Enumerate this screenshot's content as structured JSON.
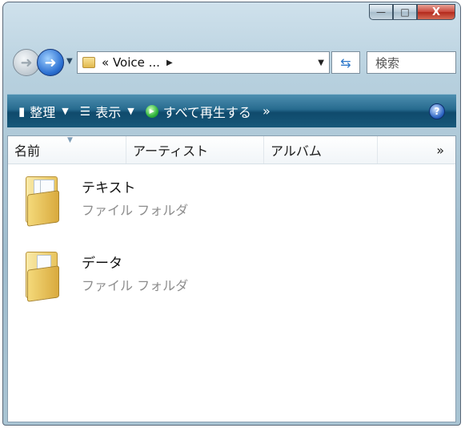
{
  "window": {
    "caption_buttons": {
      "minimize": "—",
      "maximize": "□",
      "close": "X"
    }
  },
  "address": {
    "path_text": "« Voice ...",
    "search_placeholder": "検索",
    "icons": {
      "back": "back-arrow-icon",
      "forward": "forward-arrow-icon",
      "refresh": "refresh-icon"
    }
  },
  "toolbar": {
    "organize": "整理",
    "views": "表示",
    "play_all": "すべて再生する",
    "overflow": "»",
    "help": "?"
  },
  "columns": {
    "name": "名前",
    "artist": "アーティスト",
    "album": "アルバム",
    "more": "»"
  },
  "items": [
    {
      "name": "テキスト",
      "type": "ファイル フォルダ"
    },
    {
      "name": "データ",
      "type": "ファイル フォルダ"
    }
  ],
  "colors": {
    "command_bar": "#1a5a7d",
    "window_frame": "#a9c4d3",
    "close_button": "#c9463a"
  }
}
